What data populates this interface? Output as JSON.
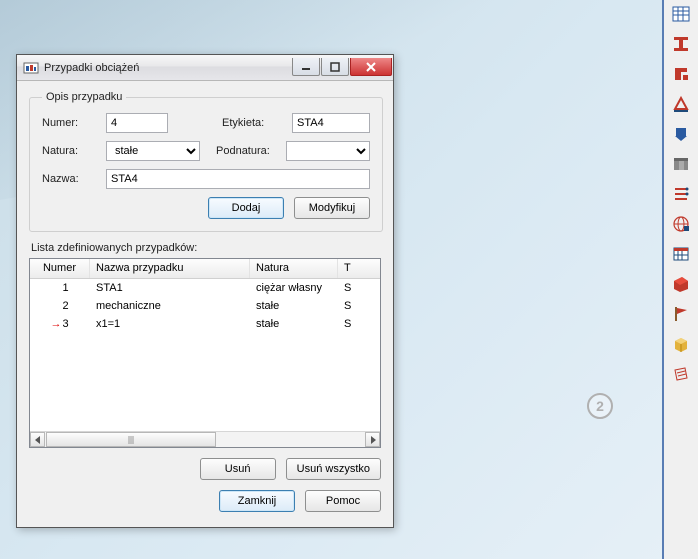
{
  "viewport": {
    "node_label": "2"
  },
  "dialog": {
    "title": "Przypadki obciążeń",
    "groupbox_legend": "Opis przypadku",
    "labels": {
      "numer": "Numer:",
      "etykieta": "Etykieta:",
      "natura": "Natura:",
      "podnatura": "Podnatura:",
      "nazwa": "Nazwa:"
    },
    "fields": {
      "numer": "4",
      "etykieta": "STA4",
      "natura": "stałe",
      "podnatura": "",
      "nazwa": "STA4"
    },
    "buttons": {
      "dodaj": "Dodaj",
      "modyfikuj": "Modyfikuj",
      "usun": "Usuń",
      "usun_wszystko": "Usuń wszystko",
      "zamknij": "Zamknij",
      "pomoc": "Pomoc"
    },
    "list_label": "Lista zdefiniowanych przypadków:",
    "columns": {
      "numer": "Numer",
      "nazwa": "Nazwa przypadku",
      "natura": "Natura",
      "t": "T"
    },
    "rows": [
      {
        "marker": "",
        "numer": "1",
        "nazwa": "STA1",
        "natura": "ciężar własny",
        "t": "S"
      },
      {
        "marker": "",
        "numer": "2",
        "nazwa": "mechaniczne",
        "natura": "stałe",
        "t": "S"
      },
      {
        "marker": "→",
        "numer": "3",
        "nazwa": "x1=1",
        "natura": "stałe",
        "t": "S"
      }
    ]
  },
  "toolbar_icons": [
    "table-icon",
    "ibeam-icon",
    "section-red-icon",
    "support-icon",
    "load-blue-icon",
    "panel-icon",
    "bars-red-icon",
    "globe-icon",
    "calendar-icon",
    "extrude-red-icon",
    "flag-red-icon",
    "box-yellow-icon",
    "sheet-icon"
  ]
}
